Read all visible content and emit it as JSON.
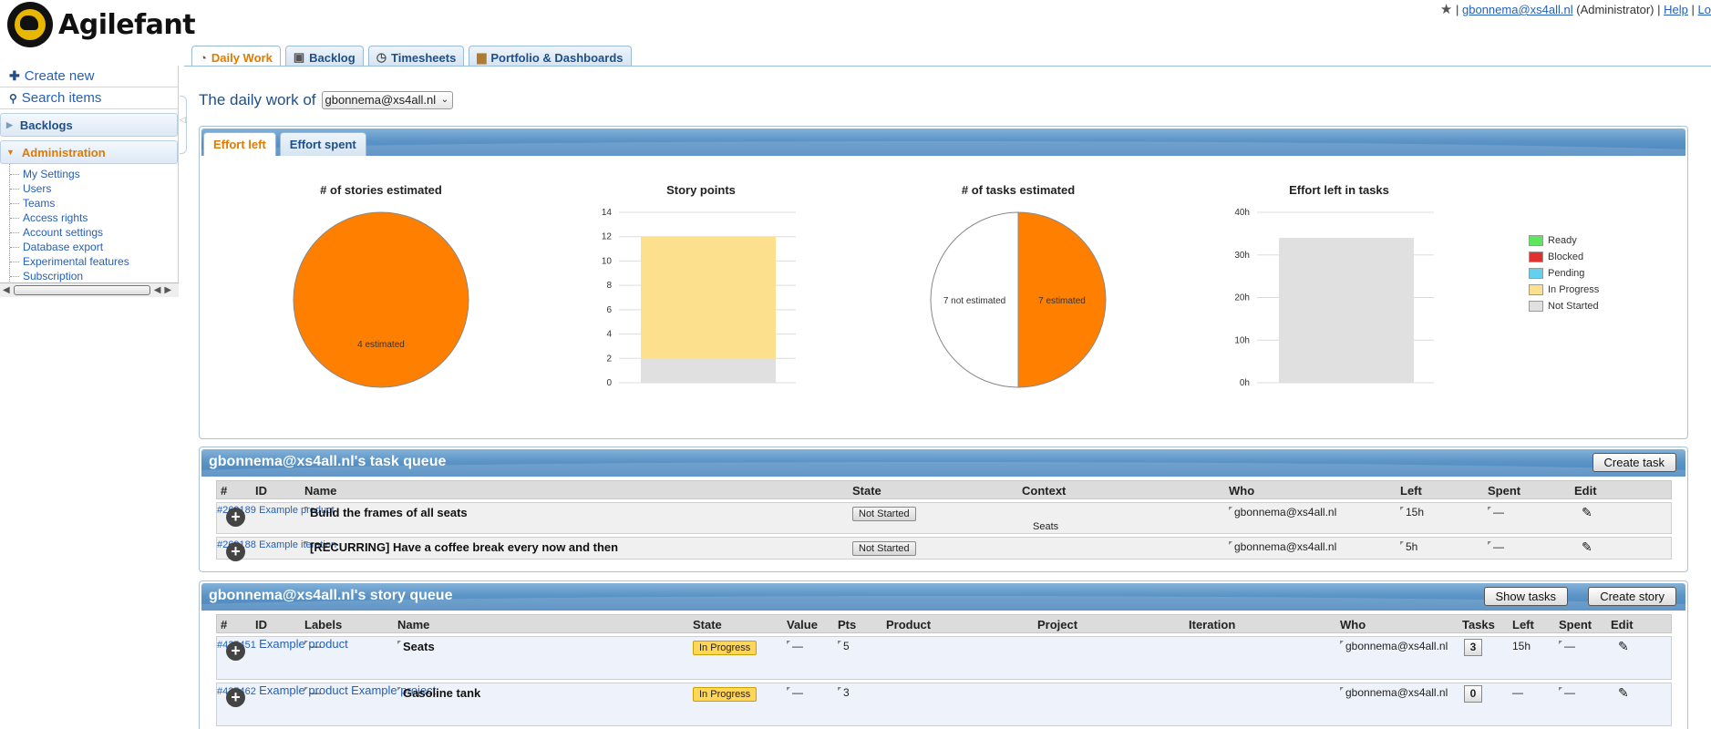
{
  "app": {
    "name": "Agilefant"
  },
  "userbar": {
    "star": "★",
    "sep1": "|",
    "user": "gbonnema@xs4all.nl",
    "role": "(Administrator)",
    "sep2": "|",
    "help": "Help",
    "sep3": "|",
    "logout": "Lo"
  },
  "tabs": [
    {
      "label": "Daily Work",
      "icon": "speedometer-icon"
    },
    {
      "label": "Backlog",
      "icon": "cube-icon"
    },
    {
      "label": "Timesheets",
      "icon": "clock-icon"
    },
    {
      "label": "Portfolio & Dashboards",
      "icon": "briefcase-icon"
    }
  ],
  "sidebar": {
    "create_new": "Create new",
    "search_items": "Search items",
    "backlogs": "Backlogs",
    "administration": "Administration",
    "admin_items": [
      "My Settings",
      "Users",
      "Teams",
      "Access rights",
      "Account settings",
      "Database export",
      "Experimental features",
      "Subscription"
    ]
  },
  "daily": {
    "title": "The daily work of",
    "selected_user": "gbonnema@xs4all.nl"
  },
  "effort_tabs": [
    "Effort left",
    "Effort spent"
  ],
  "colors": {
    "ready": "#5de65d",
    "blocked": "#e03030",
    "pending": "#64d0f0",
    "in_progress": "#fde08e",
    "not_started": "#e0e0e0",
    "orange": "#ff8000"
  },
  "chart_data": [
    {
      "type": "pie",
      "title": "# of stories estimated",
      "slices": [
        {
          "label": "4 estimated",
          "value": 4,
          "color": "#ff8000"
        }
      ]
    },
    {
      "type": "bar",
      "title": "Story points",
      "ylim": [
        0,
        14
      ],
      "yticks": [
        "0",
        "2",
        "4",
        "6",
        "8",
        "10",
        "12",
        "14"
      ],
      "stack": [
        {
          "name": "Not Started",
          "value": 2,
          "color": "#e0e0e0"
        },
        {
          "name": "In Progress",
          "value": 10,
          "color": "#fde08e"
        }
      ]
    },
    {
      "type": "pie",
      "title": "# of tasks estimated",
      "slices": [
        {
          "label": "7 estimated",
          "value": 7,
          "color": "#ff8000"
        },
        {
          "label": "7 not estimated",
          "value": 7,
          "color": "#ffffff"
        }
      ]
    },
    {
      "type": "bar",
      "title": "Effort left in tasks",
      "ylim": [
        0,
        40
      ],
      "yticks": [
        "0h",
        "10h",
        "20h",
        "30h",
        "40h"
      ],
      "stack": [
        {
          "name": "Not Started",
          "value": 34,
          "color": "#e0e0e0"
        }
      ]
    }
  ],
  "legend": [
    "Ready",
    "Blocked",
    "Pending",
    "In Progress",
    "Not Started"
  ],
  "task_queue": {
    "title": "gbonnema@xs4all.nl's task queue",
    "create_button": "Create task",
    "columns": [
      "#",
      "ID",
      "Name",
      "State",
      "Context",
      "Who",
      "Left",
      "Spent",
      "Edit"
    ],
    "rows": [
      {
        "id": "#269189",
        "name": "Build the frames of all seats",
        "state": "Not Started",
        "context": "Example product",
        "context_sub": "Seats",
        "who": "gbonnema@xs4all.nl",
        "left": "15h",
        "spent": "—"
      },
      {
        "id": "#269188",
        "name": "[RECURRING] Have a coffee break every now and then",
        "state": "Not Started",
        "context": "Example iteration",
        "context_sub": "",
        "who": "gbonnema@xs4all.nl",
        "left": "5h",
        "spent": "—"
      }
    ]
  },
  "story_queue": {
    "title": "gbonnema@xs4all.nl's story queue",
    "show_tasks_button": "Show tasks",
    "create_button": "Create story",
    "columns": [
      "#",
      "ID",
      "Labels",
      "Name",
      "State",
      "Value",
      "Pts",
      "Product",
      "Project",
      "Iteration",
      "Who",
      "Tasks",
      "Left",
      "Spent",
      "Edit"
    ],
    "rows": [
      {
        "id": "#425451",
        "labels": "—",
        "name": "Seats",
        "state": "In Progress",
        "value": "—",
        "pts": "5",
        "product": "Example product",
        "project": "",
        "iteration": "",
        "who": "gbonnema@xs4all.nl",
        "tasks": "3",
        "left": "15h",
        "spent": "—"
      },
      {
        "id": "#425462",
        "labels": "—",
        "name": "Gasoline tank",
        "state": "In Progress",
        "value": "—",
        "pts": "3",
        "product": "Example product",
        "project": "Example project",
        "iteration": "",
        "who": "gbonnema@xs4all.nl",
        "tasks": "0",
        "left": "—",
        "spent": "—"
      }
    ]
  }
}
